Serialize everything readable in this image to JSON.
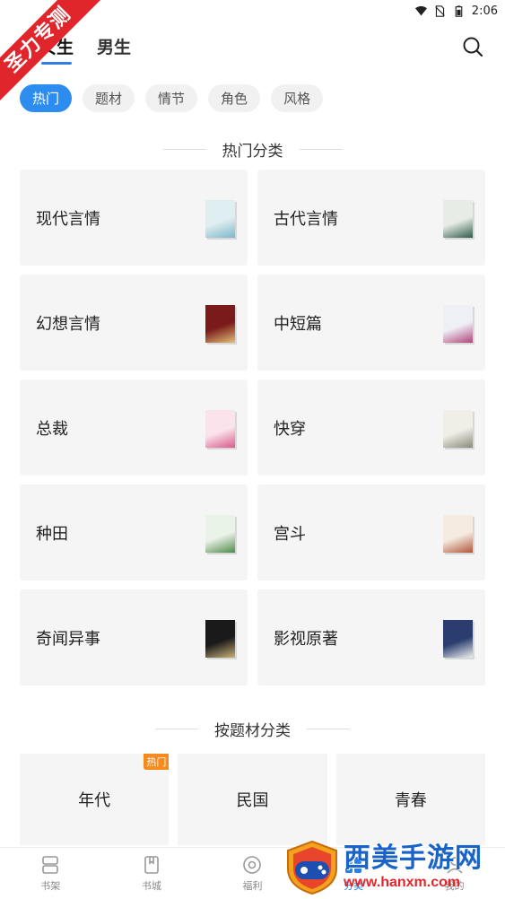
{
  "status_bar": {
    "time": "2:06"
  },
  "ribbon": {
    "text": "圣力专测"
  },
  "top_tabs": [
    {
      "label": "女生",
      "active": true
    },
    {
      "label": "男生",
      "active": false
    }
  ],
  "chips": [
    {
      "label": "热门",
      "active": true
    },
    {
      "label": "题材",
      "active": false
    },
    {
      "label": "情节",
      "active": false
    },
    {
      "label": "角色",
      "active": false
    },
    {
      "label": "风格",
      "active": false
    }
  ],
  "sections": {
    "hot": "热门分类",
    "topic": "按题材分类"
  },
  "hot_categories": [
    {
      "label": "现代言情",
      "cover": {
        "bg": "#dfeef0",
        "accent": "#7fb7c9"
      }
    },
    {
      "label": "古代言情",
      "cover": {
        "bg": "#e7ece6",
        "accent": "#2f5b4a"
      }
    },
    {
      "label": "幻想言情",
      "cover": {
        "bg": "#7a1a1a",
        "accent": "#e3c07a"
      }
    },
    {
      "label": "中短篇",
      "cover": {
        "bg": "#eef0f6",
        "accent": "#b0447a"
      }
    },
    {
      "label": "总裁",
      "cover": {
        "bg": "#fbe3ec",
        "accent": "#d95a8a"
      }
    },
    {
      "label": "快穿",
      "cover": {
        "bg": "#efefe8",
        "accent": "#8a8a7a"
      }
    },
    {
      "label": "种田",
      "cover": {
        "bg": "#eaf3e8",
        "accent": "#4f8a4a"
      }
    },
    {
      "label": "宫斗",
      "cover": {
        "bg": "#f6ebe0",
        "accent": "#b0563a"
      }
    },
    {
      "label": "奇闻异事",
      "cover": {
        "bg": "#1a1a1a",
        "accent": "#c9b07a"
      }
    },
    {
      "label": "影视原著",
      "cover": {
        "bg": "#2a3d6e",
        "accent": "#f0f0f0"
      }
    }
  ],
  "topic_categories": [
    {
      "label": "年代",
      "badge": "热门"
    },
    {
      "label": "民国",
      "badge": ""
    },
    {
      "label": "青春",
      "badge": ""
    }
  ],
  "bottom_nav": [
    {
      "label": "书架",
      "icon": "bookshelf-icon",
      "active": false
    },
    {
      "label": "书城",
      "icon": "bookstore-icon",
      "active": false
    },
    {
      "label": "福利",
      "icon": "welfare-icon",
      "active": false
    },
    {
      "label": "分类",
      "icon": "category-icon",
      "active": true
    },
    {
      "label": "我的",
      "icon": "profile-icon",
      "active": false
    }
  ],
  "watermark": {
    "title": "西美手游网",
    "url": "www.hanxm.com"
  },
  "colors": {
    "accent": "#2d8cf0",
    "ribbon": "#e0262b",
    "hot_badge": "#f58a1f"
  }
}
